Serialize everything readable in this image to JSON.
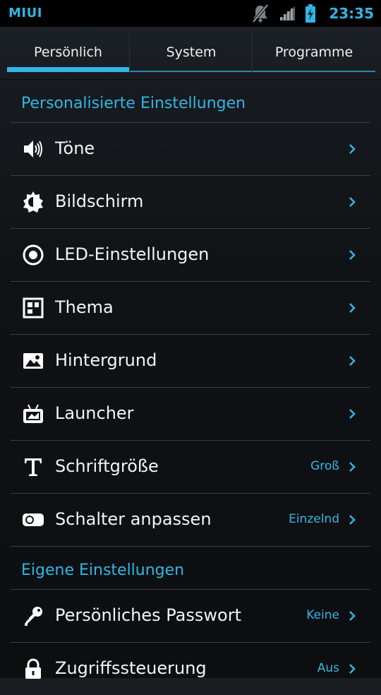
{
  "status_bar": {
    "carrier": "MIUI",
    "time": "23:35",
    "icons": [
      "mute-icon",
      "signal-icon",
      "battery-charging-icon"
    ]
  },
  "tabs": [
    {
      "label": "Persönlich",
      "active": true
    },
    {
      "label": "System",
      "active": false
    },
    {
      "label": "Programme",
      "active": false
    }
  ],
  "sections": [
    {
      "title": "Personalisierte Einstellungen",
      "items": [
        {
          "label": "Töne",
          "icon": "speaker-icon",
          "value": ""
        },
        {
          "label": "Bildschirm",
          "icon": "brightness-icon",
          "value": ""
        },
        {
          "label": "LED-Einstellungen",
          "icon": "led-icon",
          "value": ""
        },
        {
          "label": "Thema",
          "icon": "theme-icon",
          "value": ""
        },
        {
          "label": "Hintergrund",
          "icon": "wallpaper-icon",
          "value": ""
        },
        {
          "label": "Launcher",
          "icon": "launcher-icon",
          "value": ""
        },
        {
          "label": "Schriftgröße",
          "icon": "font-icon",
          "value": "Groß"
        },
        {
          "label": "Schalter anpassen",
          "icon": "toggle-icon",
          "value": "Einzelnd"
        }
      ]
    },
    {
      "title": "Eigene Einstellungen",
      "items": [
        {
          "label": "Persönliches Passwort",
          "icon": "key-icon",
          "value": "Keine"
        },
        {
          "label": "Zugriffssteuerung",
          "icon": "lock-icon",
          "value": "Aus"
        }
      ]
    }
  ],
  "colors": {
    "accent": "#33b5e5",
    "background": "#111417",
    "divider": "#3a3f45"
  }
}
